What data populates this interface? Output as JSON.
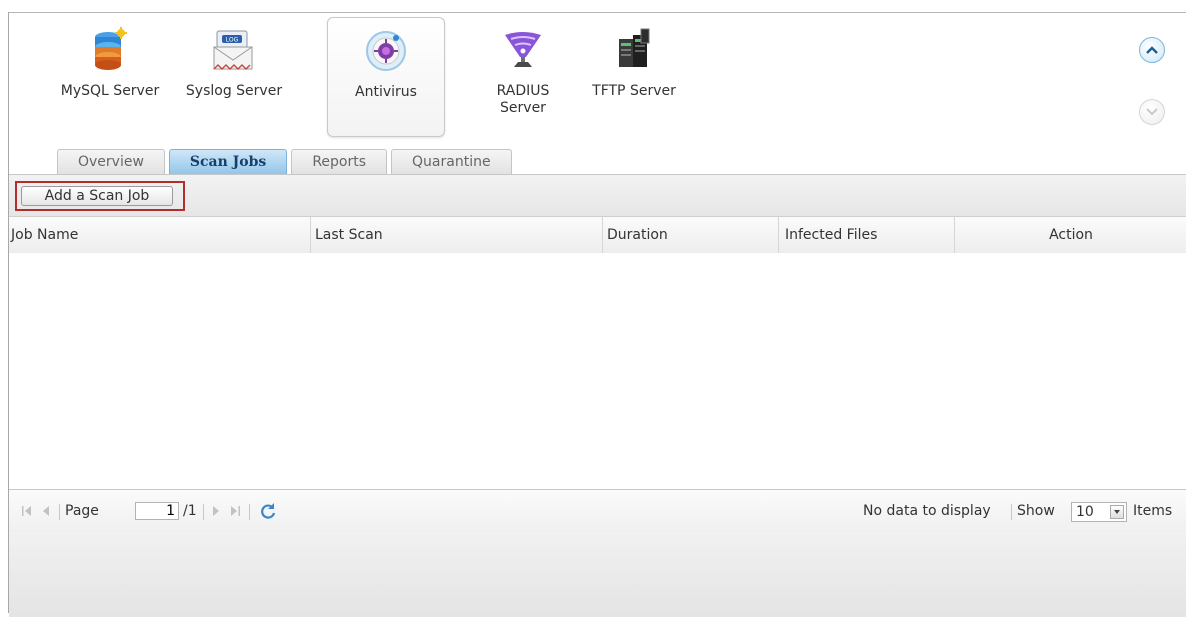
{
  "apps": [
    {
      "label": "MySQL Server",
      "icon": "database-icon"
    },
    {
      "label": "Syslog Server",
      "icon": "log-envelope-icon"
    },
    {
      "label": "Antivirus",
      "icon": "virus-shield-icon",
      "selected": true
    },
    {
      "label": "RADIUS\nServer",
      "icon": "radius-antenna-icon"
    },
    {
      "label": "TFTP Server",
      "icon": "server-tower-icon"
    }
  ],
  "scroll": {
    "up_icon": "chevron-up-icon",
    "down_icon": "chevron-down-icon"
  },
  "tabs": [
    {
      "label": "Overview"
    },
    {
      "label": "Scan Jobs",
      "active": true
    },
    {
      "label": "Reports"
    },
    {
      "label": "Quarantine"
    }
  ],
  "toolbar": {
    "add_scan_job_label": "Add a Scan Job"
  },
  "grid": {
    "columns": [
      "Job Name",
      "Last Scan",
      "Duration",
      "Infected Files",
      "Action"
    ],
    "rows": []
  },
  "pager": {
    "page_label": "Page",
    "page_value": "1",
    "total_pages": "/1",
    "status": "No data to display",
    "show_label": "Show",
    "show_value": "10",
    "items_label": "Items"
  },
  "colors": {
    "active_tab": "#93c6ea",
    "highlight_border": "#b42d2d",
    "scroll_up_accent": "#7bb6dc"
  }
}
